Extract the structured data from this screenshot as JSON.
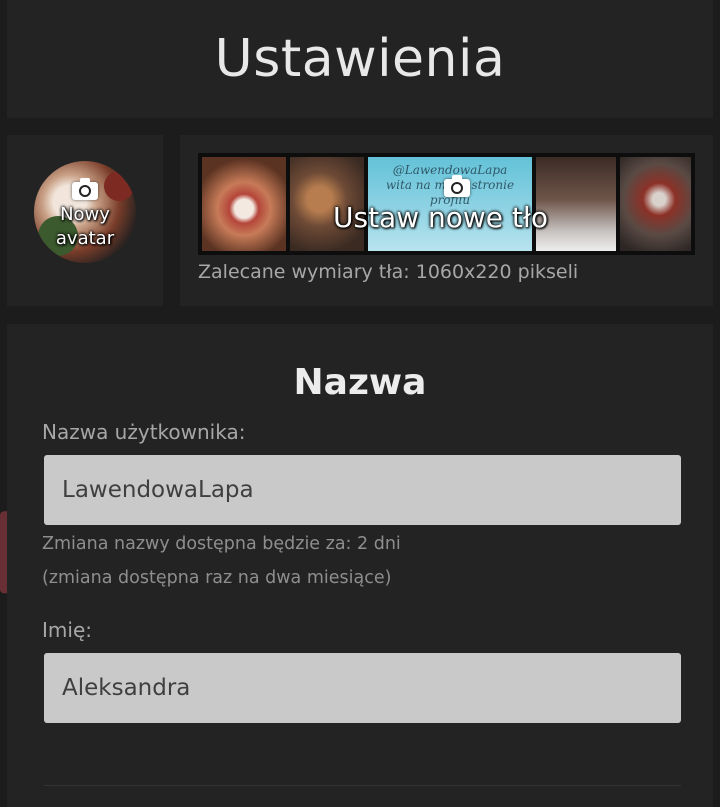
{
  "header": {
    "title": "Ustawienia"
  },
  "avatar": {
    "label_line1": "Nowy",
    "label_line2": "avatar",
    "icon": "camera-icon"
  },
  "background": {
    "label": "Ustaw nowe tło",
    "banner_text_line1": "@LawendowaLapa",
    "banner_text_line2": "wita na mojej stronie",
    "banner_text_line3": "profilu",
    "hint": "Zalecane wymiary tła: 1060x220 pikseli",
    "icon": "camera-icon"
  },
  "form": {
    "title": "Nazwa",
    "username": {
      "label": "Nazwa użytkownika:",
      "value": "LawendowaLapa",
      "hint_line1": "Zmiana nazwy dostępna będzie za: 2 dni",
      "hint_line2": "(zmiana dostępna raz na dwa miesiące)"
    },
    "first_name": {
      "label": "Imię:",
      "value": "Aleksandra"
    }
  },
  "colors": {
    "highlight": "#c64852",
    "panel": "#232323",
    "input": "#c9c9c9"
  }
}
